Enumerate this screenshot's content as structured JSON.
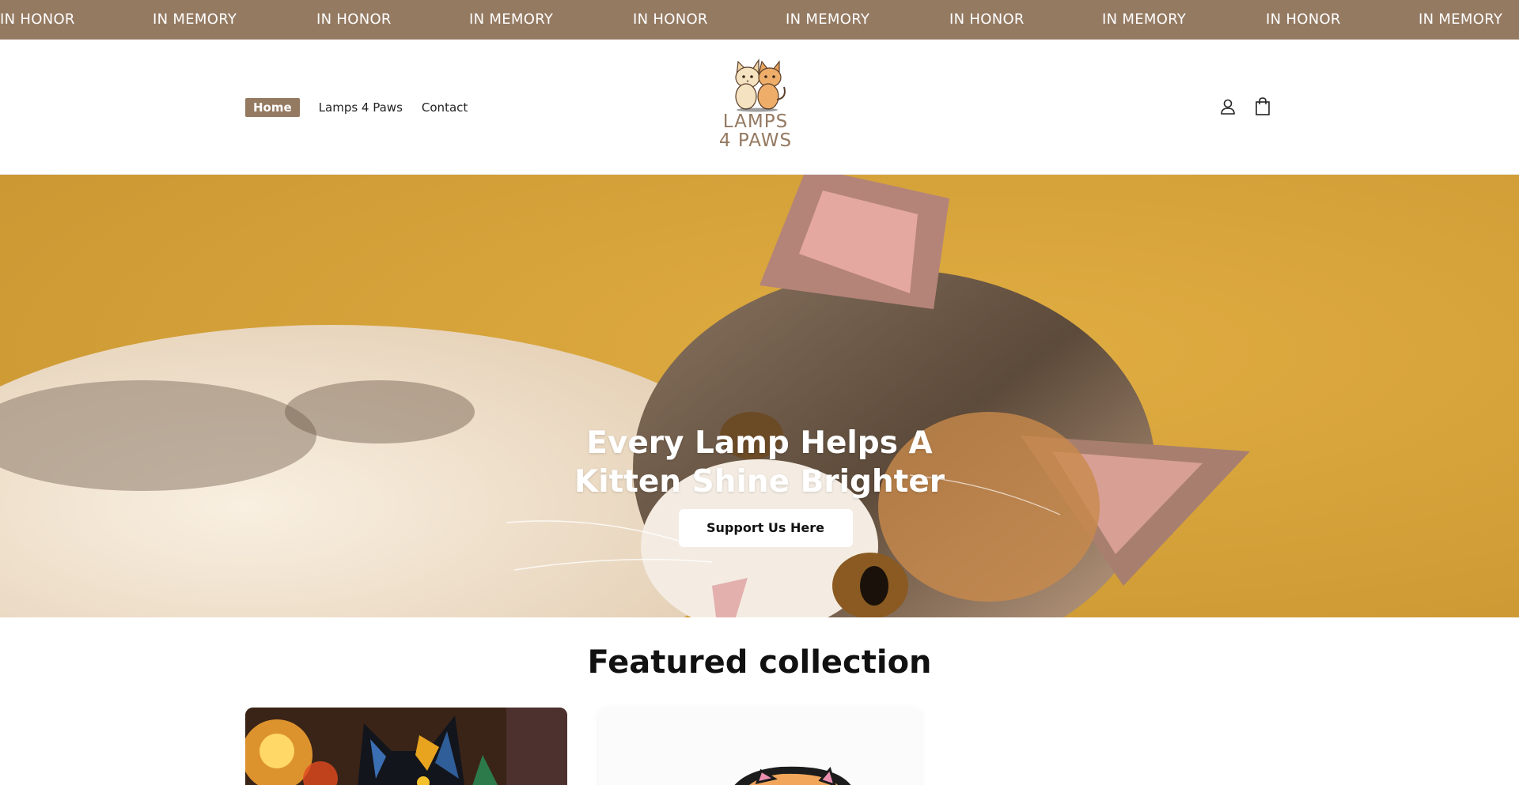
{
  "announcement": {
    "items": [
      "IN HONOR",
      "IN MEMORY",
      "IN HONOR",
      "IN MEMORY",
      "IN HONOR",
      "IN MEMORY",
      "IN HONOR",
      "IN MEMORY",
      "IN HONOR",
      "IN MEMORY"
    ]
  },
  "header": {
    "nav": [
      {
        "label": "Home",
        "active": true
      },
      {
        "label": "Lamps 4 Paws",
        "active": false
      },
      {
        "label": "Contact",
        "active": false
      }
    ],
    "logo": {
      "line1": "LAMPS",
      "line2": "4 PAWS"
    },
    "icons": [
      "account-icon",
      "cart-icon"
    ]
  },
  "hero": {
    "title_line1": "Every Lamp Helps A",
    "title_line2": "Kitten Shine Brighter",
    "button_label": "Support Us Here"
  },
  "featured": {
    "title": "Featured collection"
  },
  "colors": {
    "brand": "#957a62",
    "hero_bg": "#d8a436",
    "white": "#ffffff"
  }
}
